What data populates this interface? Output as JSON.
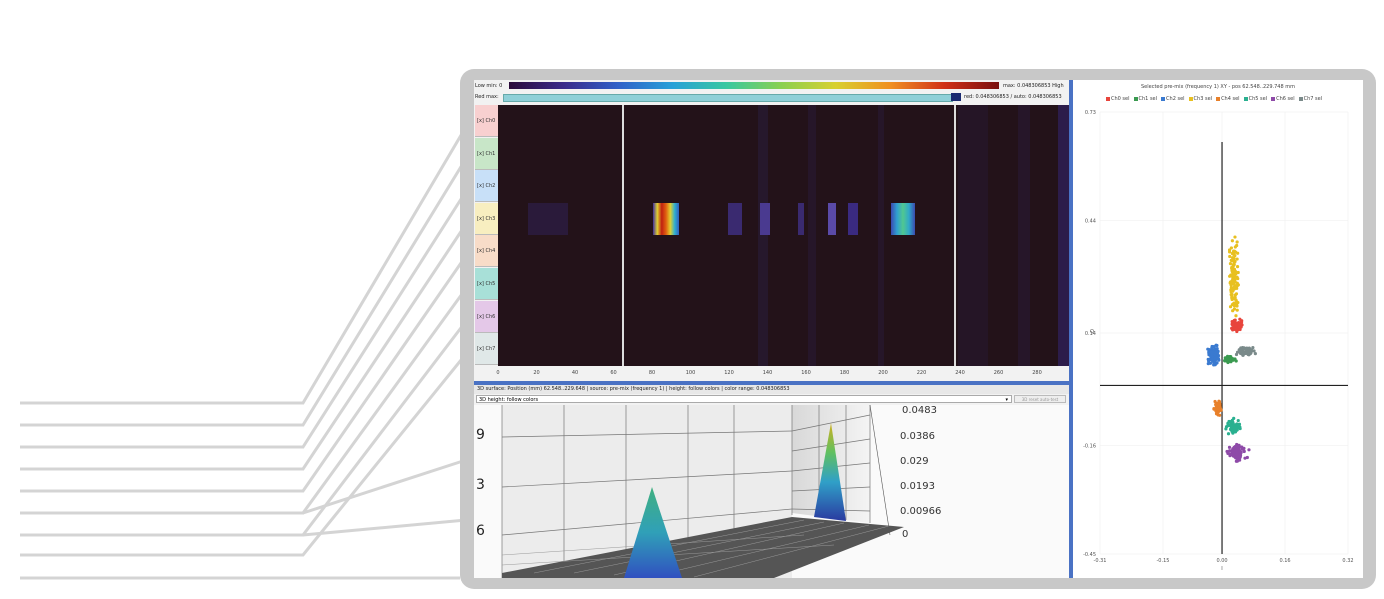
{
  "colorbar": {
    "low_label": "Low min: 0",
    "max_label": "max: 0.048306853  High"
  },
  "redmax": {
    "label": "Red max:",
    "value_label": "red: 0.048306853 / auto: 0.048306853"
  },
  "channels": [
    {
      "label": "[x] Ch0",
      "color": "#f8d0d0"
    },
    {
      "label": "[x] Ch1",
      "color": "#c8e6c8"
    },
    {
      "label": "[x] Ch2",
      "color": "#c8e0f8"
    },
    {
      "label": "[x] Ch3",
      "color": "#f8eec0"
    },
    {
      "label": "[x] Ch4",
      "color": "#f8dcc8"
    },
    {
      "label": "[x] Ch5",
      "color": "#a8e0d8"
    },
    {
      "label": "[x] Ch6",
      "color": "#e4c8e8"
    },
    {
      "label": "[x] Ch7",
      "color": "#e0e8e8"
    }
  ],
  "heatmap_xaxis": [
    "0",
    "20",
    "40",
    "60",
    "80",
    "100",
    "120",
    "140",
    "160",
    "180",
    "200",
    "220",
    "240",
    "260",
    "280"
  ],
  "info_line": "3D surface: Position (mm) 62.548..229.648 | source: pre-mix (frequency 1) | height: follow colors | color range: 0.048306853",
  "height_select": "3D height: follow colors",
  "reset_button": "3D reset auto-test",
  "z_ticks": [
    "0.0483",
    "0.0386",
    "0.029",
    "0.0193",
    "0.00966",
    "0"
  ],
  "partial_y_ticks": [
    "9",
    "3",
    "6"
  ],
  "scatter": {
    "title": "Selected pre-mix (frequency 1) XY - pos 62.548..229.748 mm",
    "legend": [
      {
        "label": "Ch0 sel",
        "color": "#e8453c"
      },
      {
        "label": "Ch1 sel",
        "color": "#3a9a50"
      },
      {
        "label": "Ch2 sel",
        "color": "#3a7ad0"
      },
      {
        "label": "Ch3 sel",
        "color": "#e8c020"
      },
      {
        "label": "Ch4 sel",
        "color": "#e8802a"
      },
      {
        "label": "Ch5 sel",
        "color": "#2ab090"
      },
      {
        "label": "Ch6 sel",
        "color": "#8e4aa8"
      },
      {
        "label": "Ch7 sel",
        "color": "#7a8a8a"
      }
    ],
    "y_ticks": [
      "0.73",
      "0.44",
      "0.14",
      "-0.16",
      "-0.45"
    ],
    "x_ticks": [
      "-0.31",
      "-0.15",
      "0.00",
      "0.16",
      "0.32"
    ],
    "ylabel": "Q",
    "xlabel": "I"
  },
  "chart_data": {
    "type": "scatter",
    "title": "Selected pre-mix (frequency 1) XY - pos 62.548..229.748 mm",
    "xlabel": "I",
    "ylabel": "Q",
    "xlim": [
      -0.31,
      0.32
    ],
    "ylim": [
      -0.45,
      0.73
    ],
    "grid": true,
    "legend": "top",
    "clusters": [
      {
        "name": "Ch0 sel",
        "center": [
          0.04,
          0.16
        ],
        "spread": [
          0.02,
          0.02
        ],
        "n": 70
      },
      {
        "name": "Ch1 sel",
        "center": [
          0.02,
          0.07
        ],
        "spread": [
          0.02,
          0.012
        ],
        "n": 30
      },
      {
        "name": "Ch2 sel",
        "center": [
          -0.02,
          0.08
        ],
        "spread": [
          0.02,
          0.035
        ],
        "n": 90
      },
      {
        "name": "Ch3 sel",
        "center": [
          0.03,
          0.3
        ],
        "spread": [
          0.015,
          0.16
        ],
        "n": 120
      },
      {
        "name": "Ch4 sel",
        "center": [
          -0.01,
          -0.06
        ],
        "spread": [
          0.012,
          0.03
        ],
        "n": 60
      },
      {
        "name": "Ch5 sel",
        "center": [
          0.03,
          -0.11
        ],
        "spread": [
          0.025,
          0.025
        ],
        "n": 70
      },
      {
        "name": "Ch6 sel",
        "center": [
          0.04,
          -0.18
        ],
        "spread": [
          0.03,
          0.03
        ],
        "n": 90
      },
      {
        "name": "Ch7 sel",
        "center": [
          0.06,
          0.09
        ],
        "spread": [
          0.03,
          0.015
        ],
        "n": 70
      }
    ]
  }
}
